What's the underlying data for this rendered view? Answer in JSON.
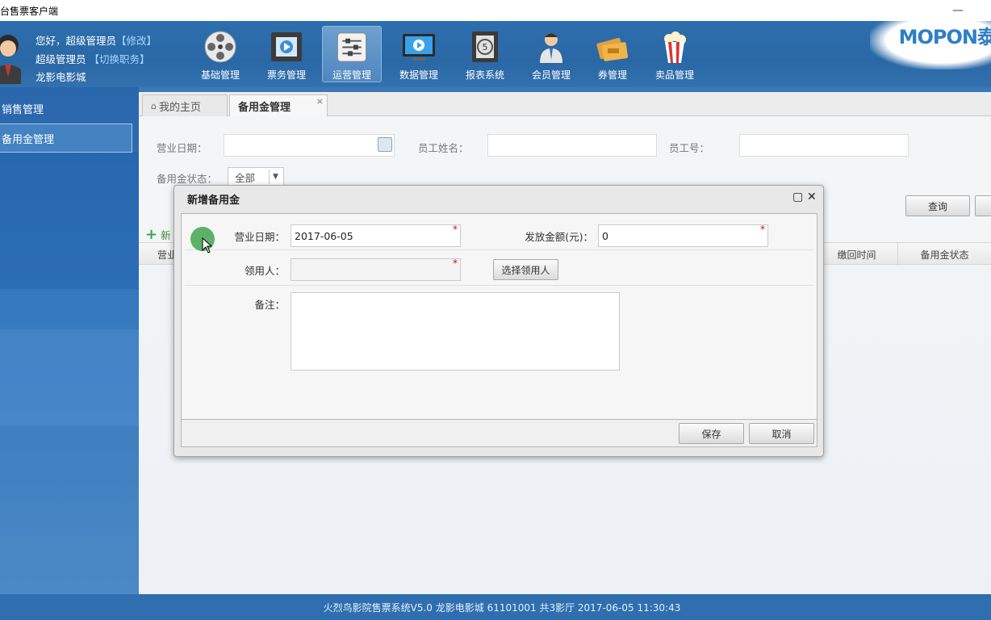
{
  "window": {
    "title": "后台售票客户端",
    "minimize": "—",
    "maximize": "☐"
  },
  "header": {
    "greeting": "您好，超级管理员",
    "edit_link": "【修改】",
    "role": "超级管理员",
    "switch_link": "【切换职务】",
    "cinema": "龙影电影城",
    "brand": "MOPON泰",
    "nav": [
      {
        "label": "基础管理",
        "icon": "film-reel-icon"
      },
      {
        "label": "票务管理",
        "icon": "film-strip-play-icon"
      },
      {
        "label": "运营管理",
        "icon": "sliders-icon"
      },
      {
        "label": "数据管理",
        "icon": "monitor-play-icon"
      },
      {
        "label": "报表系统",
        "icon": "film-countdown-icon"
      },
      {
        "label": "会员管理",
        "icon": "member-person-icon"
      },
      {
        "label": "券管理",
        "icon": "tickets-icon"
      },
      {
        "label": "卖品管理",
        "icon": "popcorn-icon"
      }
    ]
  },
  "sidebar": {
    "items": [
      {
        "label": "销售管理"
      },
      {
        "label": "备用金管理"
      }
    ]
  },
  "tabs": [
    {
      "label": "我的主页",
      "icon": "home-icon"
    },
    {
      "label": "备用金管理",
      "close": "×"
    }
  ],
  "filters": {
    "business_date_label": "营业日期：",
    "employee_name_label": "员工姓名：",
    "employee_no_label": "员工号：",
    "status_label": "备用金状态：",
    "status_value": "全部",
    "query_button": "查询",
    "add_button": "新"
  },
  "grid": {
    "columns": [
      "营业",
      "缴回时间",
      "备用金状态"
    ]
  },
  "dialog": {
    "title": "新增备用金",
    "business_date_label": "营业日期：",
    "business_date_value": "2017-06-05",
    "amount_label": "发放金额(元)：",
    "amount_value": "0",
    "recipient_label": "领用人：",
    "recipient_value": "",
    "choose_recipient_button": "选择领用人",
    "remark_label": "备注：",
    "remark_value": "",
    "required_mark": "*",
    "save_button": "保存",
    "cancel_button": "取消"
  },
  "status_bar": {
    "text": "火烈鸟影院售票系统V5.0 龙影电影城 61101001 共3影厅 2017-06-05 11:30:43"
  },
  "colors": {
    "header_bg": "#2d6fae",
    "status_bg": "#2f6fb0",
    "required": "#dd0000"
  }
}
